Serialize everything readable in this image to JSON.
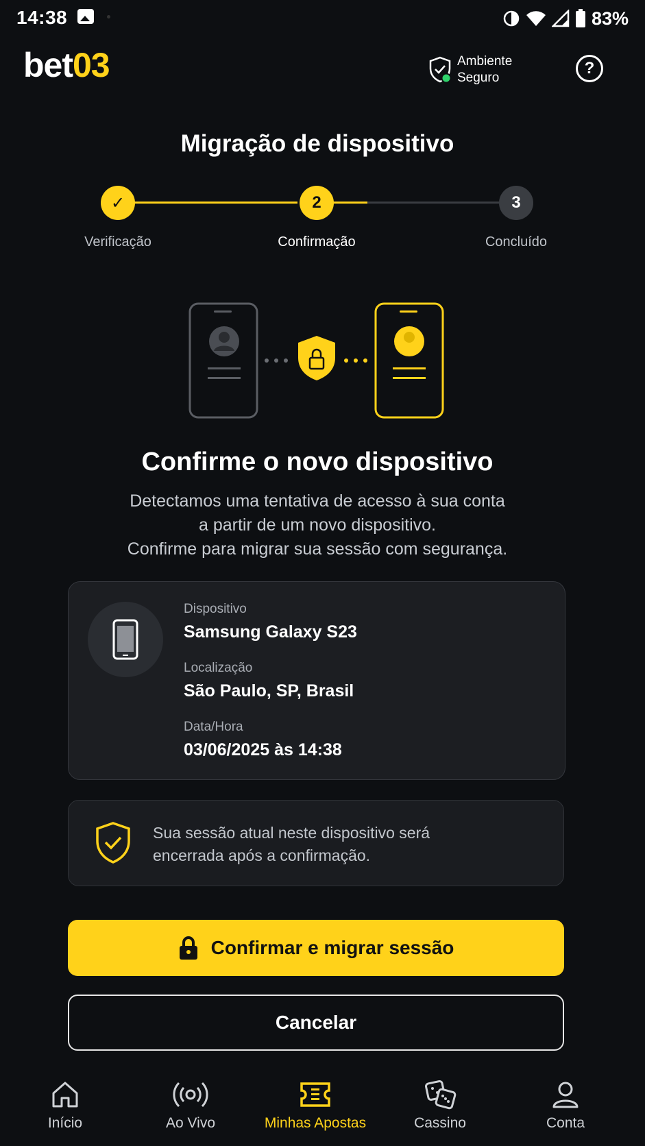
{
  "status_bar": {
    "time": "14:38",
    "battery": "83%",
    "icons": [
      "gallery-icon",
      "vibrate-icon",
      "wifi-icon",
      "signal-icon",
      "battery-icon"
    ]
  },
  "header": {
    "logo_part1": "bet",
    "logo_part2": "03",
    "secure_line1": "Ambiente",
    "secure_line2": "Seguro",
    "help_symbol": "?"
  },
  "page": {
    "title": "Migração de dispositivo"
  },
  "stepper": {
    "steps": [
      {
        "number": "✓",
        "label": "Verificação",
        "state": "done"
      },
      {
        "number": "2",
        "label": "Confirmação",
        "state": "current"
      },
      {
        "number": "3",
        "label": "Concluído",
        "state": "pending"
      }
    ]
  },
  "confirm": {
    "title": "Confirme o novo dispositivo",
    "desc_line1": "Detectamos uma tentativa de acesso à sua conta",
    "desc_line2": "a partir de um novo dispositivo.",
    "desc_line3": "Confirme para migrar sua sessão com segurança."
  },
  "device_card": {
    "device_label": "Dispositivo",
    "device_value": "Samsung Galaxy S23",
    "location_label": "Localização",
    "location_value": "São Paulo, SP, Brasil",
    "datetime_label": "Data/Hora",
    "datetime_value": "03/06/2025 às 14:38"
  },
  "info": {
    "line1": "Sua sessão atual neste dispositivo será",
    "line2": "encerrada após a confirmação."
  },
  "buttons": {
    "confirm_label": "Confirmar e migrar sessão",
    "cancel_label": "Cancelar"
  },
  "bottom_nav": {
    "items": [
      {
        "label": "Início",
        "icon": "home-icon"
      },
      {
        "label": "Ao Vivo",
        "icon": "live-icon"
      },
      {
        "label": "Minhas Apostas",
        "icon": "ticket-icon",
        "active": true
      },
      {
        "label": "Cassino",
        "icon": "dice-icon"
      },
      {
        "label": "Conta",
        "icon": "user-icon"
      }
    ]
  },
  "colors": {
    "background": "#0d0f12",
    "accent": "#ffd21a",
    "card": "#1c1e22",
    "secure_dot": "#2fd36b"
  }
}
